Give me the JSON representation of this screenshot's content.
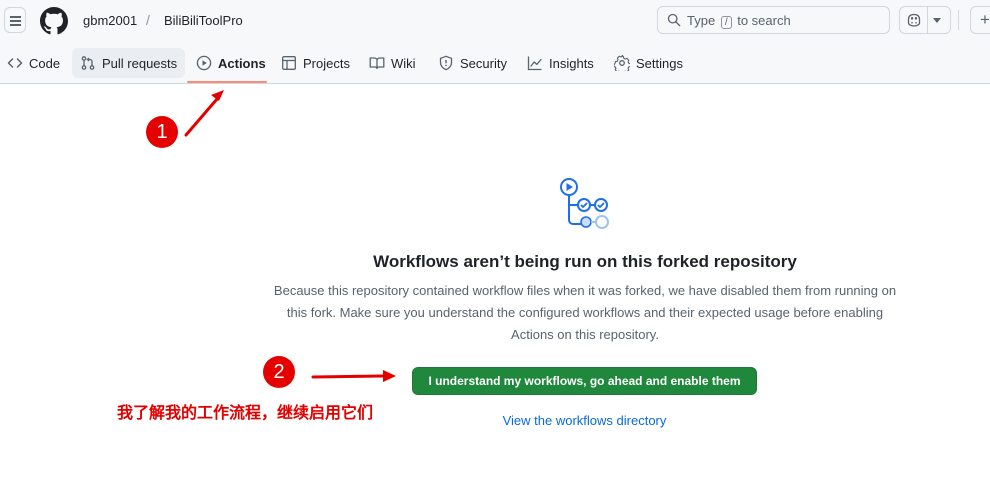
{
  "header": {
    "owner": "gbm2001",
    "separator": "/",
    "repo": "BiliBiliToolPro",
    "search": {
      "prefix": "Type",
      "key": "/",
      "suffix": "to search"
    },
    "plus_label": "+"
  },
  "nav": {
    "tabs": [
      {
        "label": "Code",
        "icon": "code-icon"
      },
      {
        "label": "Pull requests",
        "icon": "pull-request-icon"
      },
      {
        "label": "Actions",
        "icon": "play-icon",
        "active": true
      },
      {
        "label": "Projects",
        "icon": "table-icon"
      },
      {
        "label": "Wiki",
        "icon": "book-icon"
      },
      {
        "label": "Security",
        "icon": "shield-icon"
      },
      {
        "label": "Insights",
        "icon": "graph-icon"
      },
      {
        "label": "Settings",
        "icon": "gear-icon"
      }
    ]
  },
  "blank_state": {
    "title": "Workflows aren’t being run on this forked repository",
    "description": "Because this repository contained workflow files when it was forked, we have disabled them from running on this fork. Make sure you understand the configured workflows and their expected usage before enabling Actions on this repository.",
    "enable_button": "I understand my workflows, go ahead and enable them",
    "view_link": "View the workflows directory"
  },
  "annotations": {
    "badge1": "1",
    "badge2": "2",
    "note": "我了解我的工作流程，继续启用它们",
    "color": "#e50000"
  },
  "colors": {
    "accent_green": "#1f883d",
    "link_blue": "#0969da",
    "active_underline": "#fd8c73"
  }
}
